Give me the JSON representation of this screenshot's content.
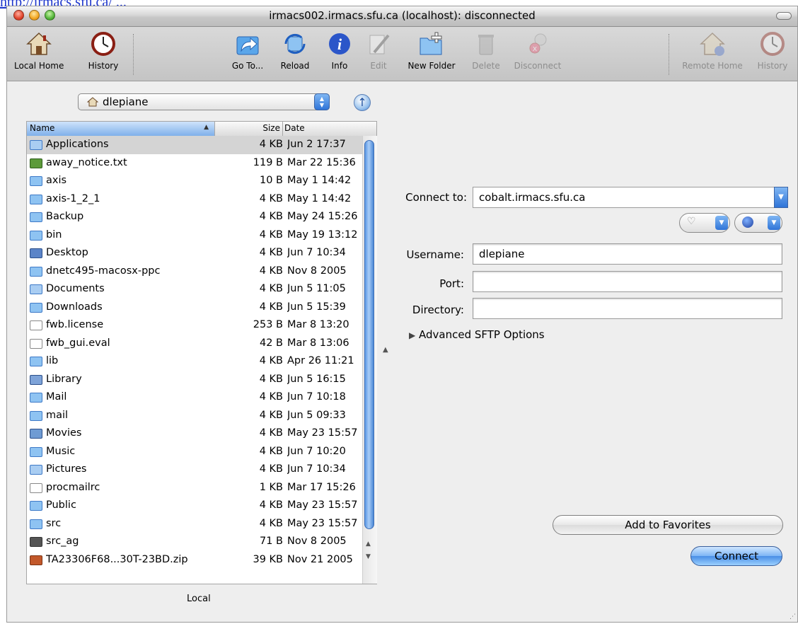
{
  "top_link": "http://irmacs.sfu.ca/ ... ",
  "window": {
    "title": "irmacs002.irmacs.sfu.ca (localhost): disconnected"
  },
  "toolbar": {
    "local_home": "Local Home",
    "history_left": "History",
    "go_to": "Go To...",
    "reload": "Reload",
    "info": "Info",
    "edit": "Edit",
    "new_folder": "New Folder",
    "delete": "Delete",
    "disconnect": "Disconnect",
    "remote_home": "Remote Home",
    "history_right": "History"
  },
  "local_panel": {
    "path_popup": "dlepiane",
    "columns": {
      "name": "Name",
      "size": "Size",
      "date": "Date"
    },
    "files": [
      {
        "name": "Applications",
        "size": "4 KB",
        "date": "Jun 2 17:37",
        "icon": "folder-apps",
        "selected": true
      },
      {
        "name": "away_notice.txt",
        "size": "119 B",
        "date": "Mar 22 15:36",
        "icon": "text-file"
      },
      {
        "name": "axis",
        "size": "10 B",
        "date": "May 1 14:42",
        "icon": "folder"
      },
      {
        "name": "axis-1_2_1",
        "size": "4 KB",
        "date": "May 1 14:42",
        "icon": "folder"
      },
      {
        "name": "Backup",
        "size": "4 KB",
        "date": "May 24 15:26",
        "icon": "folder"
      },
      {
        "name": "bin",
        "size": "4 KB",
        "date": "May 19 13:12",
        "icon": "folder"
      },
      {
        "name": "Desktop",
        "size": "4 KB",
        "date": "Jun 7 10:34",
        "icon": "folder-desktop"
      },
      {
        "name": "dnetc495-macosx-ppc",
        "size": "4 KB",
        "date": "Nov 8 2005",
        "icon": "folder"
      },
      {
        "name": "Documents",
        "size": "4 KB",
        "date": "Jun 5 11:05",
        "icon": "folder-documents"
      },
      {
        "name": "Downloads",
        "size": "4 KB",
        "date": "Jun 5 15:39",
        "icon": "folder"
      },
      {
        "name": "fwb.license",
        "size": "253 B",
        "date": "Mar 8 13:20",
        "icon": "blank-file"
      },
      {
        "name": "fwb_gui.eval",
        "size": "42 B",
        "date": "Mar 8 13:06",
        "icon": "blank-file"
      },
      {
        "name": "lib",
        "size": "4 KB",
        "date": "Apr 26 11:21",
        "icon": "folder"
      },
      {
        "name": "Library",
        "size": "4 KB",
        "date": "Jun 5 16:15",
        "icon": "folder-library"
      },
      {
        "name": "Mail",
        "size": "4 KB",
        "date": "Jun 7 10:18",
        "icon": "folder"
      },
      {
        "name": "mail",
        "size": "4 KB",
        "date": "Jun 5 09:33",
        "icon": "folder"
      },
      {
        "name": "Movies",
        "size": "4 KB",
        "date": "May 23 15:57",
        "icon": "folder-movies"
      },
      {
        "name": "Music",
        "size": "4 KB",
        "date": "Jun 7 10:20",
        "icon": "folder-music"
      },
      {
        "name": "Pictures",
        "size": "4 KB",
        "date": "Jun 7 10:34",
        "icon": "folder-pictures"
      },
      {
        "name": "procmailrc",
        "size": "1 KB",
        "date": "Mar 17 15:26",
        "icon": "blank-file"
      },
      {
        "name": "Public",
        "size": "4 KB",
        "date": "May 23 15:57",
        "icon": "folder-public"
      },
      {
        "name": "src",
        "size": "4 KB",
        "date": "May 23 15:57",
        "icon": "folder"
      },
      {
        "name": "src_ag",
        "size": "71 B",
        "date": "Nov 8 2005",
        "icon": "alias-file"
      },
      {
        "name": "TA23306F68...30T-23BD.zip",
        "size": "39 KB",
        "date": "Nov 21 2005",
        "icon": "zip-file"
      }
    ],
    "footer_label": "Local"
  },
  "connect_panel": {
    "connect_to_label": "Connect to:",
    "connect_to_value": "cobalt.irmacs.sfu.ca",
    "username_label": "Username:",
    "username_value": "dlepiane",
    "port_label": "Port:",
    "port_value": "",
    "directory_label": "Directory:",
    "directory_value": "",
    "advanced_label": "Advanced SFTP Options",
    "add_favorites": "Add to Favorites",
    "connect": "Connect"
  },
  "colors": {
    "selection_blue": "#3f7ee0",
    "folder_blue": "#8ec3f2"
  }
}
